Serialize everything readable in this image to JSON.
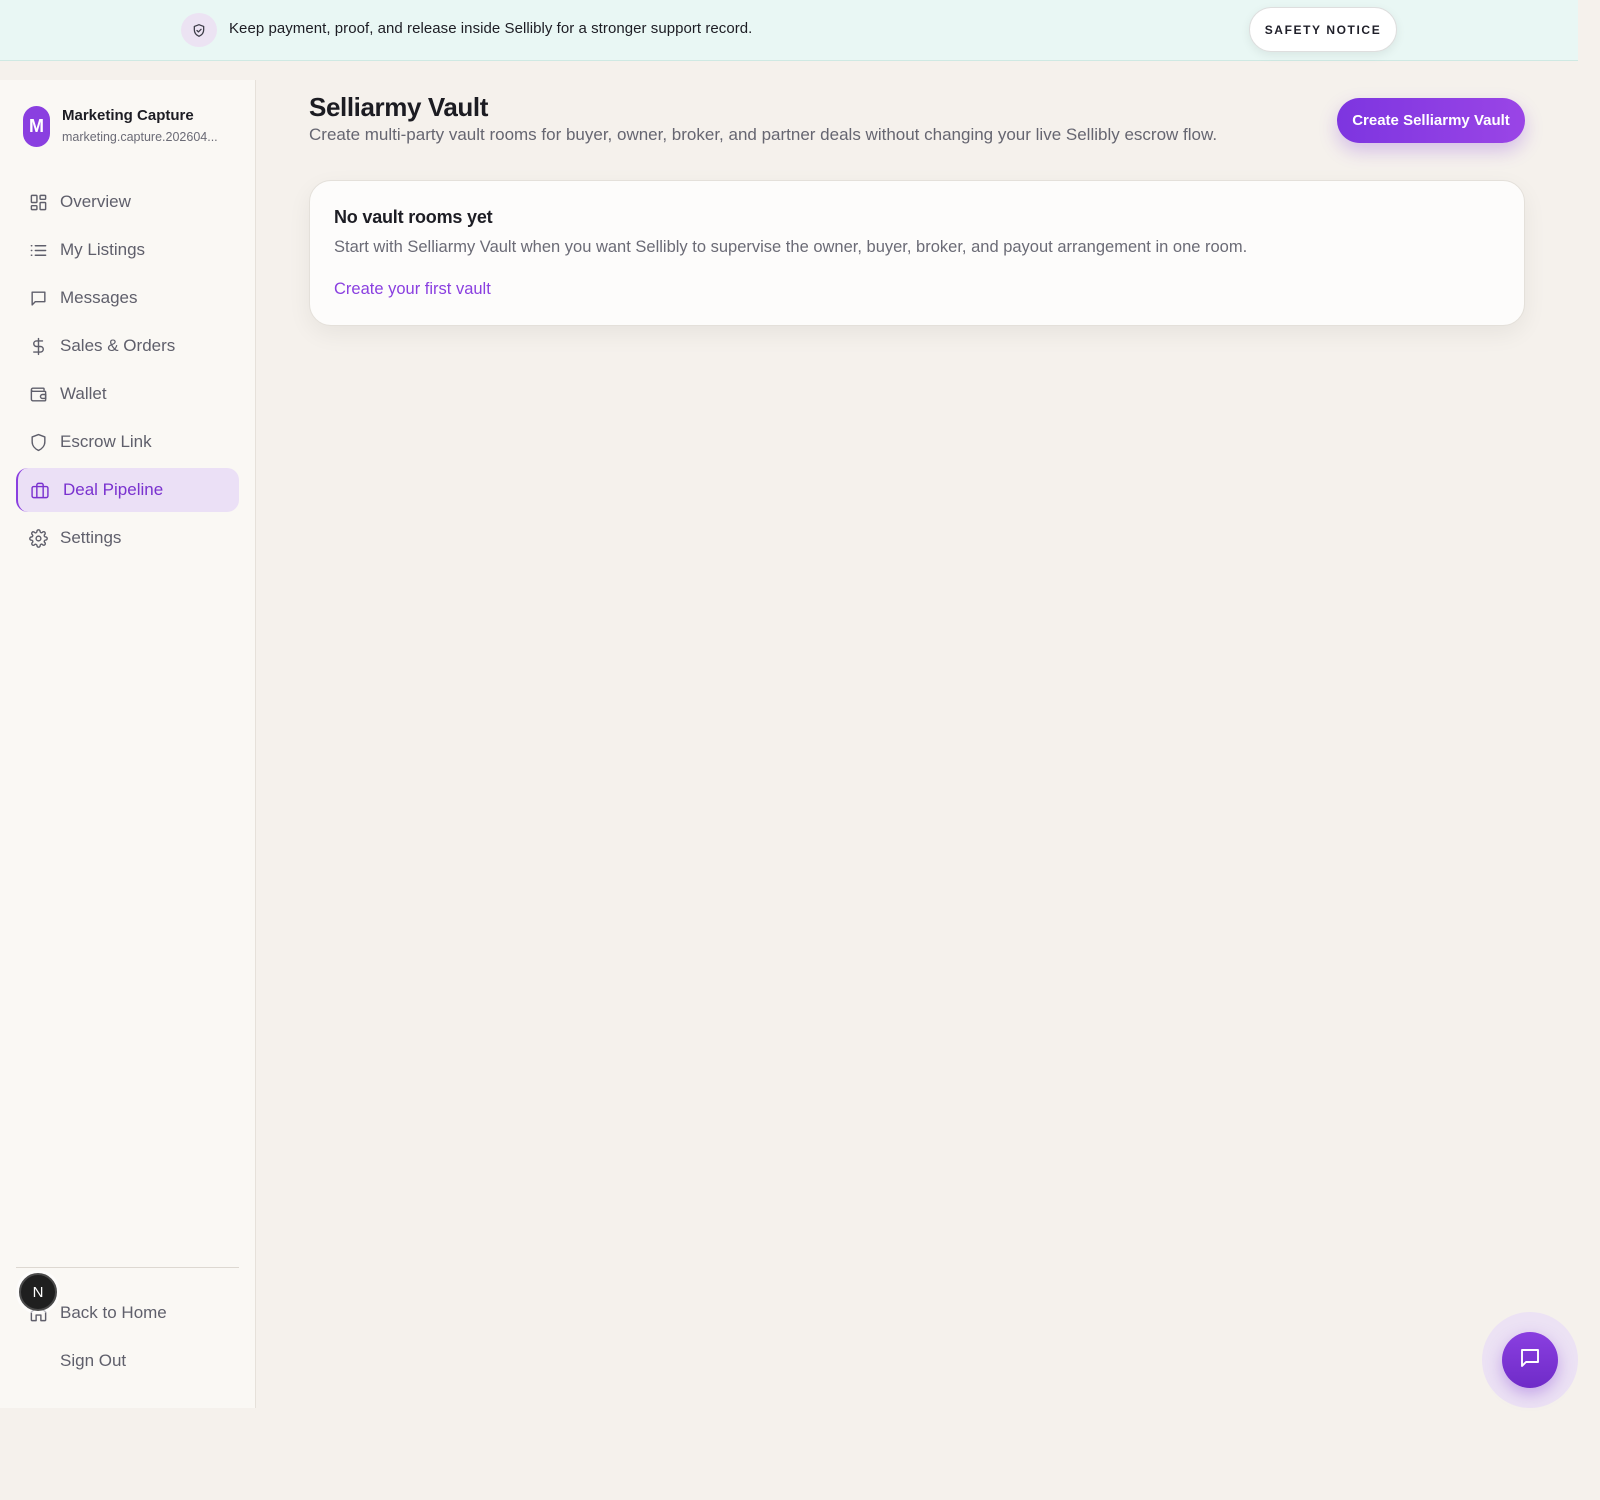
{
  "banner": {
    "icon": "shield-check-icon",
    "text": "Keep payment, proof, and release inside Sellibly for a stronger support record.",
    "safety_button": "SAFETY NOTICE"
  },
  "account": {
    "initial": "M",
    "name": "Marketing Capture",
    "email": "marketing.capture.202604..."
  },
  "sidebar": {
    "items": [
      {
        "label": "Overview",
        "icon": "grid-icon",
        "active": false
      },
      {
        "label": "My Listings",
        "icon": "list-icon",
        "active": false
      },
      {
        "label": "Messages",
        "icon": "message-icon",
        "active": false
      },
      {
        "label": "Sales & Orders",
        "icon": "dollar-icon",
        "active": false
      },
      {
        "label": "Wallet",
        "icon": "wallet-icon",
        "active": false
      },
      {
        "label": "Escrow Link",
        "icon": "shield-icon",
        "active": false
      },
      {
        "label": "Deal Pipeline",
        "icon": "briefcase-icon",
        "active": true
      },
      {
        "label": "Settings",
        "icon": "gear-icon",
        "active": false
      }
    ],
    "footer": [
      {
        "label": "Back to Home",
        "icon": "home-icon"
      },
      {
        "label": "Sign Out",
        "icon": "sign-out-icon"
      }
    ],
    "user_badge": "N"
  },
  "main": {
    "title": "Selliarmy Vault",
    "subtitle": "Create multi-party vault rooms for buyer, owner, broker, and partner deals without changing your live Sellibly escrow flow.",
    "create_button": "Create Selliarmy Vault",
    "empty_state": {
      "title": "No vault rooms yet",
      "body": "Start with Selliarmy Vault when you want Sellibly to supervise the owner, buyer, broker, and payout arrangement in one room.",
      "link": "Create your first vault"
    }
  },
  "colors": {
    "accent": "#8a3fe0",
    "banner_bg": "#e9f7f4",
    "page_bg": "#f5f1ec",
    "sidebar_bg": "#faf8f4",
    "active_bg": "#ebe0f6"
  }
}
